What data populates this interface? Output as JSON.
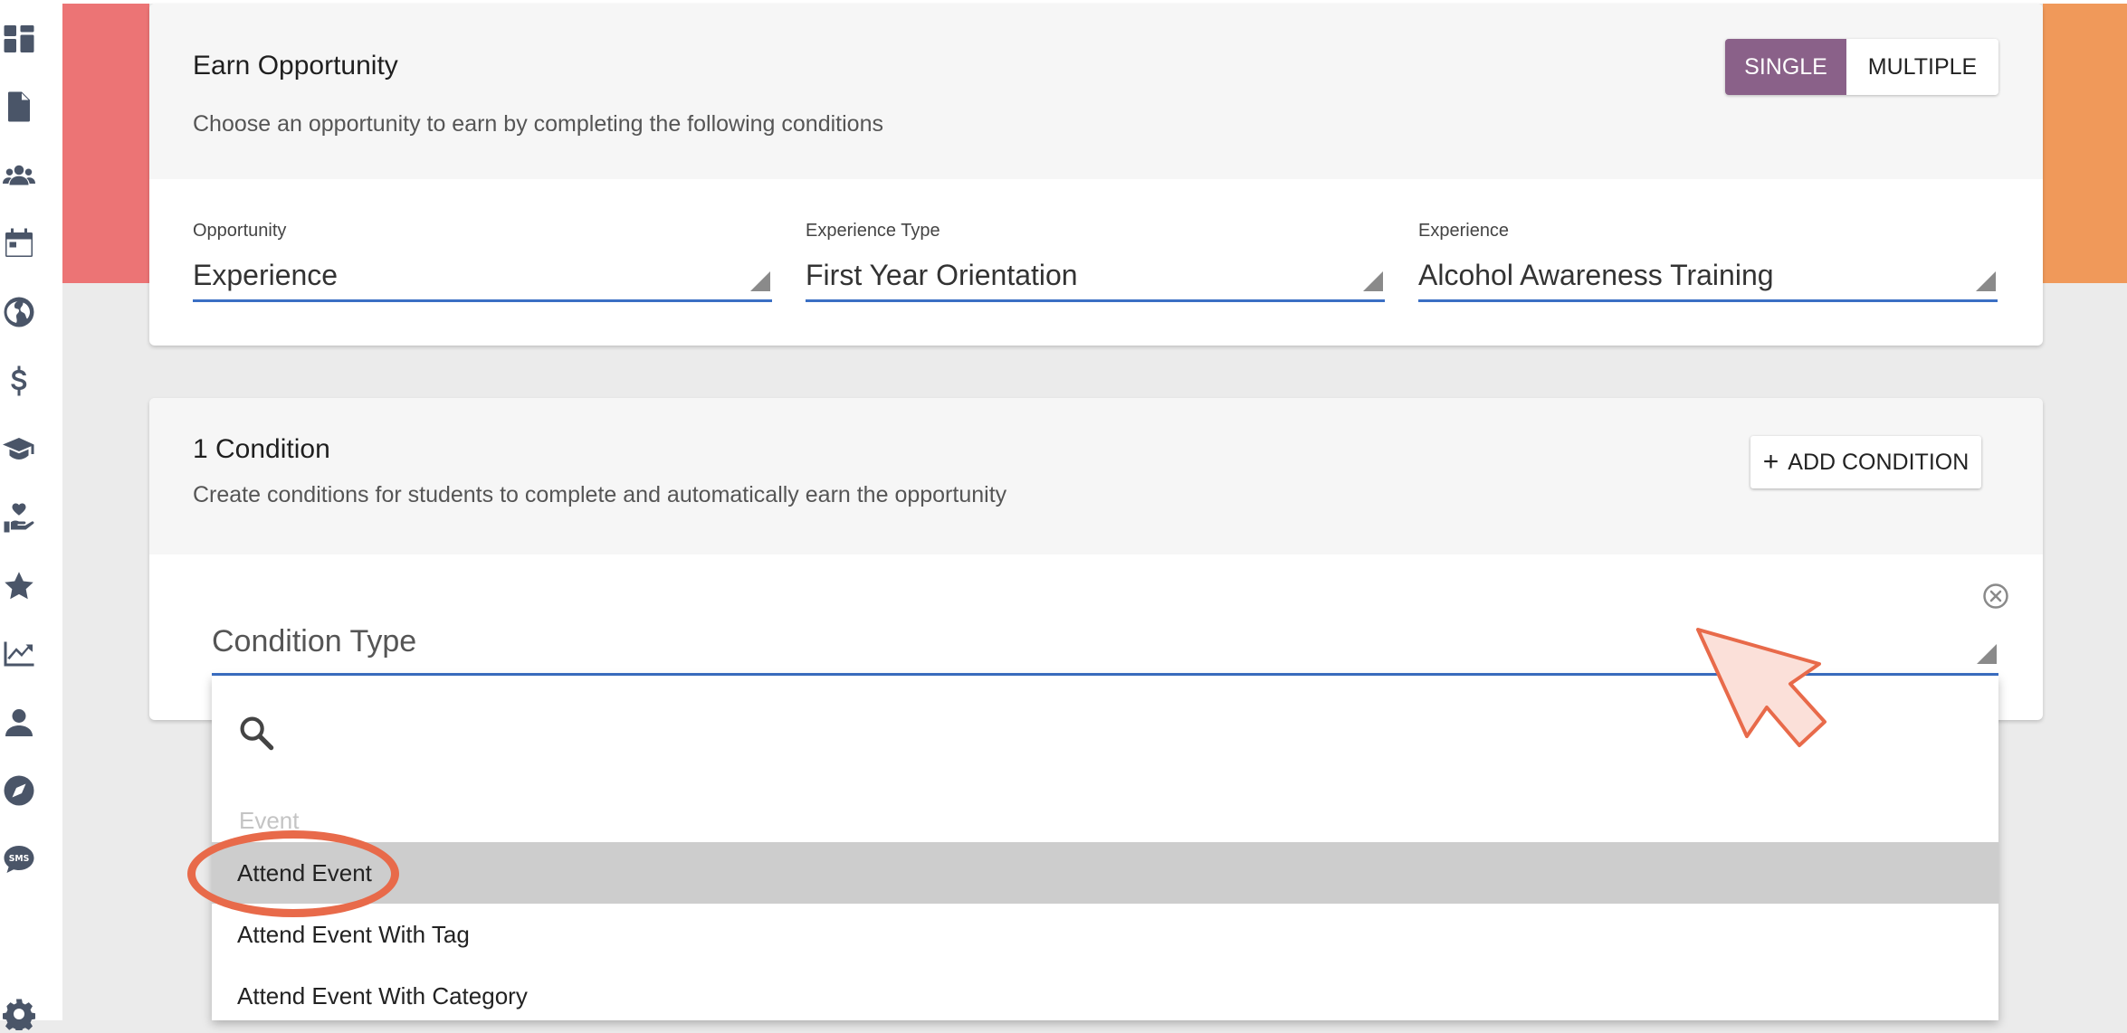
{
  "sidebar": {
    "icons": [
      "dashboard-icon",
      "document-icon",
      "users-icon",
      "calendar-icon",
      "globe-icon",
      "dollar-icon",
      "graduation-cap-icon",
      "hand-heart-icon",
      "star-icon",
      "chart-line-icon",
      "user-icon",
      "compass-icon",
      "sms-icon",
      "gear-icon"
    ],
    "sms_text": "SMS"
  },
  "earn_opportunity": {
    "title": "Earn Opportunity",
    "subtitle": "Choose an opportunity to earn by completing the following conditions",
    "toggle": {
      "single": "SINGLE",
      "multiple": "MULTIPLE",
      "selected": "SINGLE"
    },
    "fields": [
      {
        "label": "Opportunity",
        "value": "Experience"
      },
      {
        "label": "Experience Type",
        "value": "First Year Orientation"
      },
      {
        "label": "Experience",
        "value": "Alcohol Awareness Training"
      }
    ]
  },
  "conditions": {
    "title": "1 Condition",
    "subtitle": "Create conditions for students to complete and automatically earn the opportunity",
    "add_button": "ADD CONDITION",
    "add_icon": "+",
    "condition_type_label": "Condition Type"
  },
  "dropdown": {
    "search_placeholder": "",
    "group": "Event",
    "options": [
      "Attend Event",
      "Attend Event With Tag",
      "Attend Event With Category"
    ],
    "highlighted": "Attend Event"
  },
  "colors": {
    "accent_purple": "#8a6189",
    "underline_blue": "#3b6fc4",
    "deco_red": "#ec7475",
    "deco_orange": "#f0995a",
    "annotation": "#e86a4a"
  }
}
